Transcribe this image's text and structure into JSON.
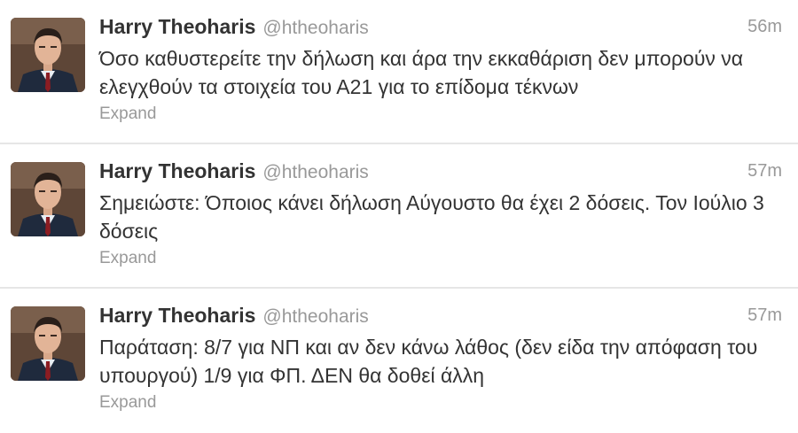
{
  "tweets": [
    {
      "name": "Harry Theoharis",
      "handle": "@htheoharis",
      "time": "56m",
      "text": "Όσο καθυστερείτε την δήλωση και άρα την εκκαθάριση δεν μπορούν να ελεγχθούν τα στοιχεία του Α21 για το επίδομα τέκνων",
      "action": "Expand"
    },
    {
      "name": "Harry Theoharis",
      "handle": "@htheoharis",
      "time": "57m",
      "text": "Σημειώστε: Όποιος κάνει δήλωση Αύγουστο θα έχει 2 δόσεις. Τον Ιούλιο 3 δόσεις",
      "action": "Expand"
    },
    {
      "name": "Harry Theoharis",
      "handle": "@htheoharis",
      "time": "57m",
      "text": "Παράταση: 8/7 για ΝΠ και αν δεν κάνω λάθος (δεν είδα την απόφαση του υπουργού) 1/9 για ΦΠ. ΔΕΝ θα δοθεί άλλη",
      "action": "Expand"
    }
  ]
}
